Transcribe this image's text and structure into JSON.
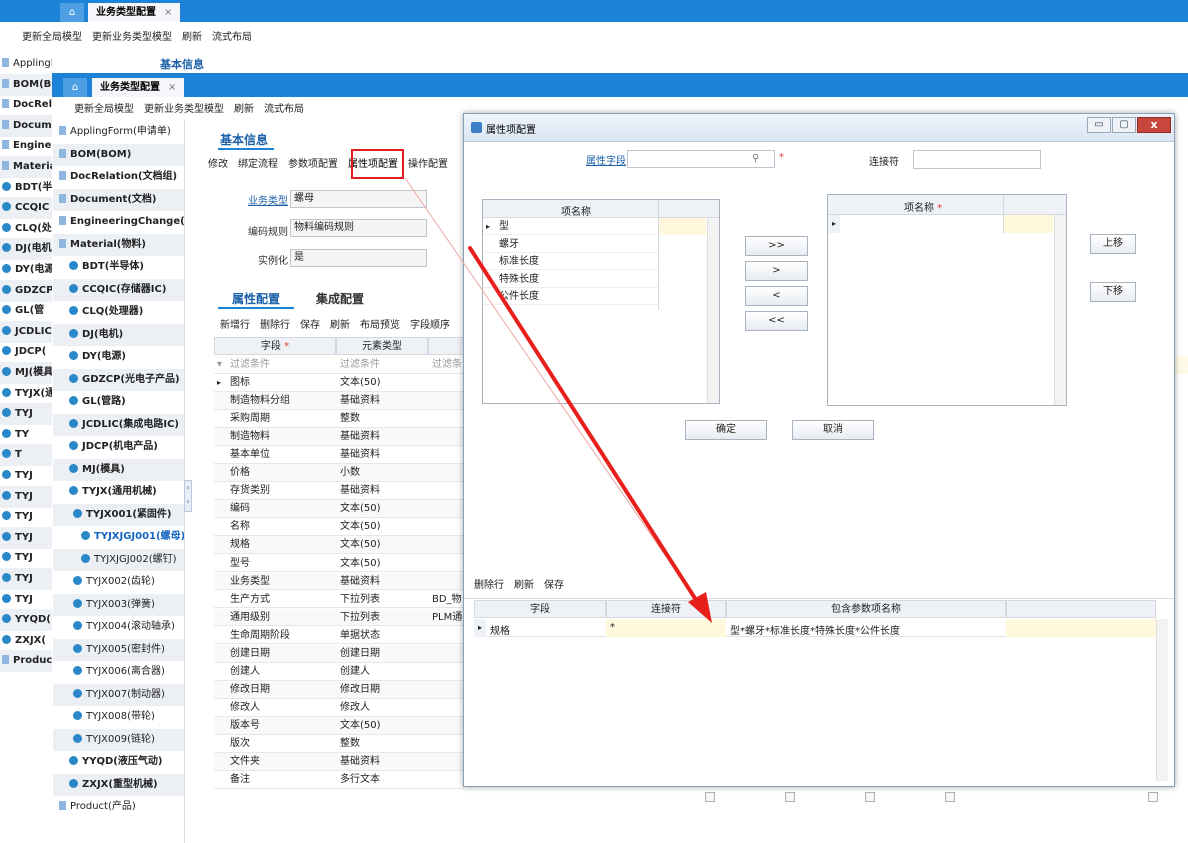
{
  "back_tabbar": {
    "home_icon": "home-icon",
    "tab_label": "业务类型配置",
    "close_glyph": "×"
  },
  "back_toolbar": [
    "更新全局模型",
    "更新业务类型模型",
    "刷新",
    "流式布局"
  ],
  "back_tree": [
    "ApplingForm(申请单)",
    "BOM(BOM",
    "DocRelati",
    "Documen",
    "Engineeri",
    "Material(",
    "BDT(半",
    "CCQIC",
    "CLQ(处",
    "DJ(电机",
    "DY(电源",
    "GDZCP",
    "GL(管",
    "JCDLIC",
    "JDCP(",
    "MJ(模具",
    "TYJX(通",
    "TYJ",
    "TY",
    "T",
    "TYJ",
    "TYJ",
    "TYJ",
    "TYJ",
    "TYJ",
    "TYJ",
    "TYJ",
    "YYQD(",
    "ZXJX(",
    "Product("
  ],
  "back_section_title": "基本信息",
  "front_tabbar": {
    "tab_label": "业务类型配置",
    "close_glyph": "×"
  },
  "front_toolbar": [
    "更新全局模型",
    "更新业务类型模型",
    "刷新",
    "流式布局"
  ],
  "front_tree": [
    "ApplingForm(申请单)",
    "BOM(BOM)",
    "DocRelation(文档组)",
    "Document(文档)",
    "EngineeringChange(变更)",
    "Material(物料)",
    "BDT(半导体)",
    "CCQIC(存储器IC)",
    "CLQ(处理器)",
    "DJ(电机)",
    "DY(电源)",
    "GDZCP(光电子产品)",
    "GL(管路)",
    "JCDLIC(集成电路IC)",
    "JDCP(机电产品)",
    "MJ(模具)",
    "TYJX(通用机械)",
    "TYJX001(紧固件)",
    "TYJXJGJ001(螺母)",
    "TYJXJGJ002(螺钉)",
    "TYJX002(齿轮)",
    "TYJX003(弹簧)",
    "TYJX004(滚动轴承)",
    "TYJX005(密封件)",
    "TYJX006(离合器)",
    "TYJX007(制动器)",
    "TYJX008(带轮)",
    "TYJX009(链轮)",
    "YYQD(液压气动)",
    "ZXJX(重型机械)",
    "Product(产品)"
  ],
  "basic_info": {
    "title": "基本信息",
    "tabs": [
      "修改",
      "绑定流程",
      "参数项配置",
      "属性项配置",
      "操作配置"
    ],
    "fields": [
      {
        "label": "业务类型",
        "value": "螺母"
      },
      {
        "label": "编码规则",
        "value": "物料编码规则"
      },
      {
        "label": "实例化",
        "value": "是"
      }
    ]
  },
  "attr_config": {
    "tab_active": "属性配置",
    "tab_other": "集成配置",
    "toolbar": [
      "新增行",
      "删除行",
      "保存",
      "刷新",
      "布局预览",
      "字段顺序"
    ],
    "col_field": "字段",
    "col_type": "元素类型",
    "filter_field": "过滤条件",
    "filter_type": "过滤条件",
    "filter_extra": "过滤条",
    "rows": [
      {
        "field": "图标",
        "type": "文本(50)",
        "extra": ""
      },
      {
        "field": "制造物料分组",
        "type": "基础资料",
        "extra": ""
      },
      {
        "field": "采购周期",
        "type": "整数",
        "extra": ""
      },
      {
        "field": "制造物料",
        "type": "基础资料",
        "extra": ""
      },
      {
        "field": "基本单位",
        "type": "基础资料",
        "extra": ""
      },
      {
        "field": "价格",
        "type": "小数",
        "extra": ""
      },
      {
        "field": "存货类别",
        "type": "基础资料",
        "extra": ""
      },
      {
        "field": "编码",
        "type": "文本(50)",
        "extra": ""
      },
      {
        "field": "名称",
        "type": "文本(50)",
        "extra": ""
      },
      {
        "field": "规格",
        "type": "文本(50)",
        "extra": ""
      },
      {
        "field": "型号",
        "type": "文本(50)",
        "extra": ""
      },
      {
        "field": "业务类型",
        "type": "基础资料",
        "extra": ""
      },
      {
        "field": "生产方式",
        "type": "下拉列表",
        "extra": "BD_物"
      },
      {
        "field": "通用级别",
        "type": "下拉列表",
        "extra": "PLM通"
      },
      {
        "field": "生命周期阶段",
        "type": "单据状态",
        "extra": ""
      },
      {
        "field": "创建日期",
        "type": "创建日期",
        "extra": ""
      },
      {
        "field": "创建人",
        "type": "创建人",
        "extra": ""
      },
      {
        "field": "修改日期",
        "type": "修改日期",
        "extra": ""
      },
      {
        "field": "修改人",
        "type": "修改人",
        "extra": ""
      },
      {
        "field": "版本号",
        "type": "文本(50)",
        "extra": ""
      },
      {
        "field": "版次",
        "type": "整数",
        "extra": ""
      },
      {
        "field": "文件夹",
        "type": "基础资料",
        "extra": ""
      },
      {
        "field": "备注",
        "type": "多行文本",
        "extra": ""
      }
    ]
  },
  "dialog": {
    "title": "属性项配置",
    "attr_field_label": "属性字段",
    "connector_label": "连接符",
    "left_list_header": "项名称",
    "left_items": [
      "型",
      "螺牙",
      "标准长度",
      "特殊长度",
      "公件长度"
    ],
    "right_list_header": "项名称",
    "move_buttons": [
      ">>",
      ">",
      "<",
      "<<"
    ],
    "up_button": "上移",
    "down_button": "下移",
    "ok_button": "确定",
    "cancel_button": "取消",
    "bottom_toolbar": [
      "删除行",
      "刷新",
      "保存"
    ],
    "bottom_cols": [
      "字段",
      "连接符",
      "包含参数项名称"
    ],
    "bottom_row": {
      "field": "规格",
      "connector": "*",
      "params": "型*螺牙*标准长度*特殊长度*公件长度"
    }
  },
  "colors": {
    "tabbar": "#1d83d8",
    "highlight_box": "#e02020",
    "arrow": "#e8201c",
    "link": "#1a5fa8"
  }
}
